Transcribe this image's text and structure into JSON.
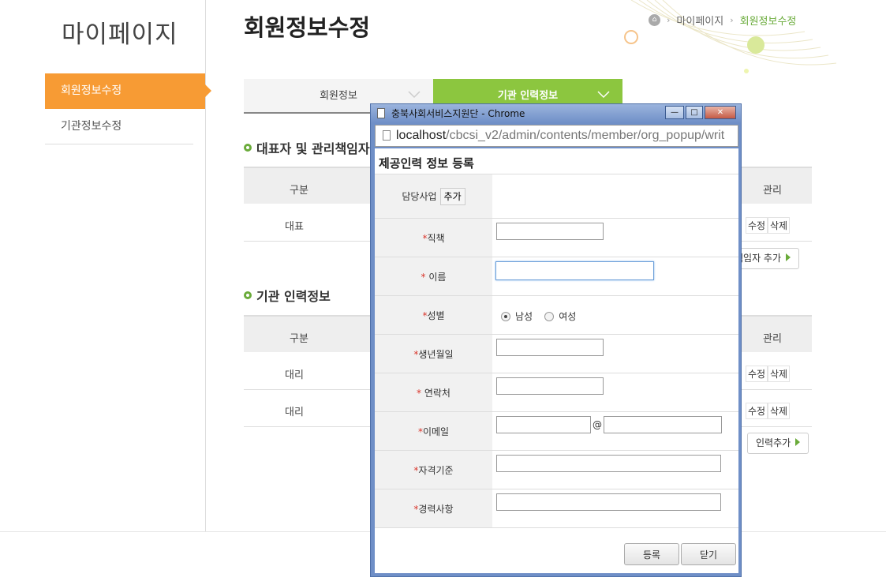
{
  "sidebar": {
    "title": "마이페이지",
    "items": [
      {
        "label": "회원정보수정",
        "active": true
      },
      {
        "label": "기관정보수정",
        "active": false
      }
    ]
  },
  "header": {
    "title": "회원정보수정",
    "breadcrumb": [
      "마이페이지",
      "회원정보수정"
    ]
  },
  "tabs": [
    {
      "label": "회원정보",
      "active": false
    },
    {
      "label": "기관 인력정보",
      "active": true
    }
  ],
  "section1": {
    "title": "대표자 및 관리책임자",
    "headers": {
      "type": "구분",
      "manage": "관리"
    },
    "rows": [
      {
        "type": "대표",
        "edit": "수정",
        "delete": "삭제"
      }
    ],
    "add_button": "책임자 추가"
  },
  "section2": {
    "title": "기관 인력정보",
    "headers": {
      "type": "구분",
      "manage": "관리"
    },
    "rows": [
      {
        "type": "대리",
        "edit": "수정",
        "delete": "삭제"
      },
      {
        "type": "대리",
        "edit": "수정",
        "delete": "삭제"
      }
    ],
    "add_button": "인력추가"
  },
  "popup": {
    "window_title": "충북사회서비스지원단 - Chrome",
    "url_host": "localhost",
    "url_path": "/cbcsi_v2/admin/contents/member/org_popup/writ",
    "form_title": "제공인력 정보 등록",
    "fields": {
      "business": {
        "label": "담당사업",
        "button": "추가"
      },
      "position": {
        "label": "직책",
        "value": ""
      },
      "name": {
        "label": " 이름",
        "value": ""
      },
      "gender": {
        "label": "성별",
        "options": [
          "남성",
          "여성"
        ],
        "selected": "남성"
      },
      "birth": {
        "label": "생년월일",
        "value": ""
      },
      "phone": {
        "label": " 연락처",
        "value": ""
      },
      "email": {
        "label": "이메일",
        "at": "@",
        "user": "",
        "domain": ""
      },
      "qualification": {
        "label": "자격기준",
        "value": ""
      },
      "career": {
        "label": "경력사항",
        "value": ""
      }
    },
    "required_mark": "*",
    "buttons": {
      "register": "등록",
      "close": "닫기"
    }
  },
  "colors": {
    "sidebar_active": "#f79b34",
    "tab_active": "#8cc63f",
    "accent_green": "#6aab3a",
    "window_frame": "#6f8fc7"
  }
}
